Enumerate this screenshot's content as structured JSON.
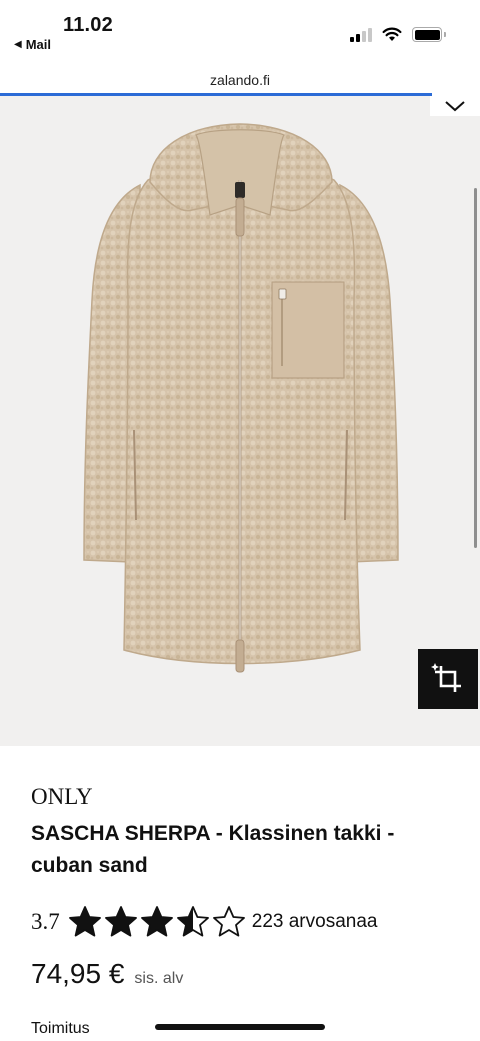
{
  "status_bar": {
    "time": "11.02",
    "back_app": "Mail",
    "back_icon": "back-triangle-icon"
  },
  "browser": {
    "url": "zalando.fi"
  },
  "product": {
    "brand": "ONLY",
    "title": "SASCHA SHERPA - Klassinen takki - cuban sand",
    "rating": {
      "value_text": "3.7",
      "value": 3.7,
      "max": 5,
      "count_text": "223 arvosanaa"
    },
    "price": "74,95 €",
    "vat_label": "sis. alv",
    "delivery_label": "Toimitus",
    "image_alt": "sherpa-coat-image"
  },
  "colors": {
    "coat": "#d6c4ab",
    "coat_shade": "#c2ae93",
    "accent_blue": "#2b6bd6",
    "image_bg": "#f1f0ef"
  }
}
